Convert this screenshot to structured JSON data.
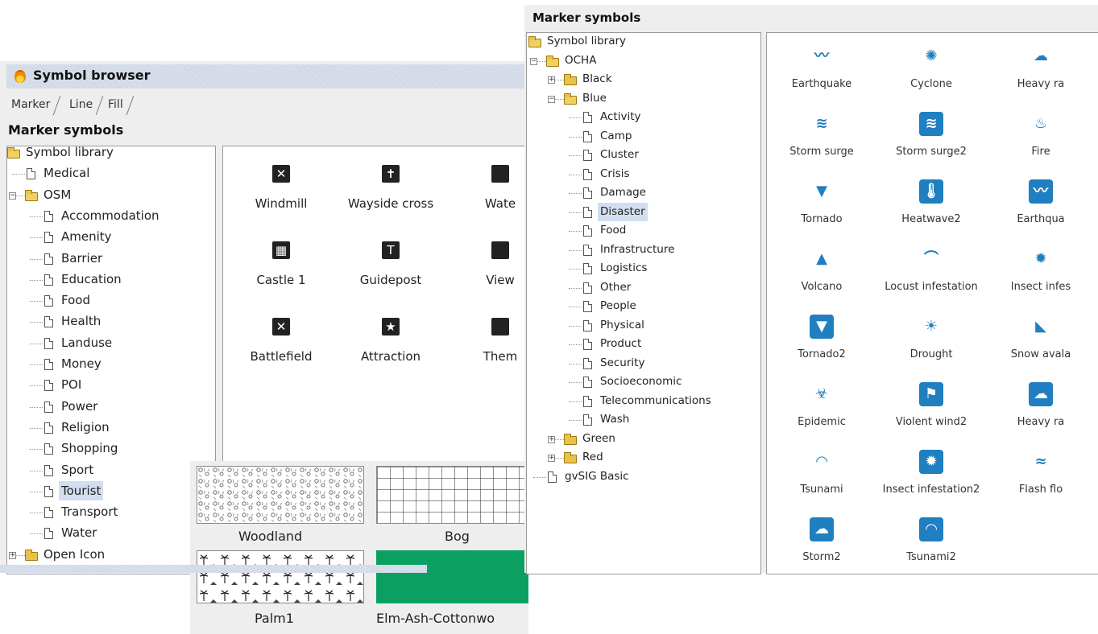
{
  "left": {
    "title": "Symbol browser",
    "tabs": [
      "Marker",
      "Line",
      "Fill"
    ],
    "header": "Marker symbols",
    "tree": [
      {
        "label": "Symbol library",
        "kind": "folder-open",
        "level": 0
      },
      {
        "label": "Medical",
        "kind": "doc",
        "level": 1
      },
      {
        "label": "OSM",
        "kind": "folder-open",
        "level": 1,
        "toggle": "-"
      },
      {
        "label": "Accommodation",
        "kind": "doc",
        "level": 2
      },
      {
        "label": "Amenity",
        "kind": "doc",
        "level": 2
      },
      {
        "label": "Barrier",
        "kind": "doc",
        "level": 2
      },
      {
        "label": "Education",
        "kind": "doc",
        "level": 2
      },
      {
        "label": "Food",
        "kind": "doc",
        "level": 2
      },
      {
        "label": "Health",
        "kind": "doc",
        "level": 2
      },
      {
        "label": "Landuse",
        "kind": "doc",
        "level": 2
      },
      {
        "label": "Money",
        "kind": "doc",
        "level": 2
      },
      {
        "label": "POI",
        "kind": "doc",
        "level": 2
      },
      {
        "label": "Power",
        "kind": "doc",
        "level": 2
      },
      {
        "label": "Religion",
        "kind": "doc",
        "level": 2
      },
      {
        "label": "Shopping",
        "kind": "doc",
        "level": 2
      },
      {
        "label": "Sport",
        "kind": "doc",
        "level": 2
      },
      {
        "label": "Tourist",
        "kind": "doc",
        "level": 2,
        "selected": true
      },
      {
        "label": "Transport",
        "kind": "doc",
        "level": 2
      },
      {
        "label": "Water",
        "kind": "doc",
        "level": 2
      },
      {
        "label": "Open Icon",
        "kind": "folder",
        "level": 1,
        "toggle": "+"
      }
    ],
    "symbols": [
      {
        "label": "Windmill",
        "icon": "windmill-icon",
        "glyph": "✕"
      },
      {
        "label": "Wayside cross",
        "icon": "wayside-cross-icon",
        "glyph": "✝"
      },
      {
        "label": "Wate",
        "icon": "water-icon",
        "glyph": ""
      },
      {
        "label": "Castle 1",
        "icon": "castle-icon",
        "glyph": "▦"
      },
      {
        "label": "Guidepost",
        "icon": "guidepost-icon",
        "glyph": "T"
      },
      {
        "label": "View",
        "icon": "viewpoint-icon",
        "glyph": ""
      },
      {
        "label": "Battlefield",
        "icon": "battlefield-icon",
        "glyph": "✕"
      },
      {
        "label": "Attraction",
        "icon": "attraction-icon",
        "glyph": "★"
      },
      {
        "label": "Them",
        "icon": "theme-park-icon",
        "glyph": ""
      }
    ],
    "fills": [
      {
        "label": "Woodland",
        "pattern": "woodland"
      },
      {
        "label": "Bog",
        "pattern": "grid"
      },
      {
        "label": "Palm1",
        "pattern": "palm"
      },
      {
        "label": "Elm-Ash-Cottonwo",
        "pattern": "solid",
        "color": "#0aa062"
      }
    ]
  },
  "right": {
    "header": "Marker symbols",
    "tree": [
      {
        "label": "Symbol library",
        "kind": "folder-open",
        "level": 0
      },
      {
        "label": "OCHA",
        "kind": "folder-open",
        "level": 1,
        "toggle": "-"
      },
      {
        "label": "Black",
        "kind": "folder",
        "level": 2,
        "toggle": "+"
      },
      {
        "label": "Blue",
        "kind": "folder-open",
        "level": 2,
        "toggle": "-"
      },
      {
        "label": "Activity",
        "kind": "doc",
        "level": 3
      },
      {
        "label": "Camp",
        "kind": "doc",
        "level": 3
      },
      {
        "label": "Cluster",
        "kind": "doc",
        "level": 3
      },
      {
        "label": "Crisis",
        "kind": "doc",
        "level": 3
      },
      {
        "label": "Damage",
        "kind": "doc",
        "level": 3
      },
      {
        "label": "Disaster",
        "kind": "doc",
        "level": 3,
        "selected": true
      },
      {
        "label": "Food",
        "kind": "doc",
        "level": 3
      },
      {
        "label": "Infrastructure",
        "kind": "doc",
        "level": 3
      },
      {
        "label": "Logistics",
        "kind": "doc",
        "level": 3
      },
      {
        "label": "Other",
        "kind": "doc",
        "level": 3
      },
      {
        "label": "People",
        "kind": "doc",
        "level": 3
      },
      {
        "label": "Physical",
        "kind": "doc",
        "level": 3
      },
      {
        "label": "Product",
        "kind": "doc",
        "level": 3
      },
      {
        "label": "Security",
        "kind": "doc",
        "level": 3
      },
      {
        "label": "Socioeconomic",
        "kind": "doc",
        "level": 3
      },
      {
        "label": "Telecommunications",
        "kind": "doc",
        "level": 3
      },
      {
        "label": "Wash",
        "kind": "doc",
        "level": 3
      },
      {
        "label": "Green",
        "kind": "folder",
        "level": 2,
        "toggle": "+"
      },
      {
        "label": "Red",
        "kind": "folder",
        "level": 2,
        "toggle": "+"
      },
      {
        "label": "gvSIG Basic",
        "kind": "doc",
        "level": 1
      }
    ],
    "symbols": [
      {
        "label": "Earthquake",
        "icon": "earthquake-icon",
        "glyph": "〰",
        "box": false
      },
      {
        "label": "Cyclone",
        "icon": "cyclone-icon",
        "glyph": "✺",
        "box": false
      },
      {
        "label": "Heavy ra",
        "icon": "heavy-rain-icon",
        "glyph": "☁",
        "box": false
      },
      {
        "label": "Storm surge",
        "icon": "storm-surge-icon",
        "glyph": "≋",
        "box": false
      },
      {
        "label": "Storm surge2",
        "icon": "storm-surge2-icon",
        "glyph": "≋",
        "box": true
      },
      {
        "label": "Fire",
        "icon": "fire-icon",
        "glyph": "♨",
        "box": false
      },
      {
        "label": "Tornado",
        "icon": "tornado-icon",
        "glyph": "▼",
        "box": false
      },
      {
        "label": "Heatwave2",
        "icon": "heatwave2-icon",
        "glyph": "🌡",
        "box": true
      },
      {
        "label": "Earthqua",
        "icon": "earthquake2-icon",
        "glyph": "〰",
        "box": true
      },
      {
        "label": "Volcano",
        "icon": "volcano-icon",
        "glyph": "▲",
        "box": false
      },
      {
        "label": "Locust infestation",
        "icon": "locust-icon",
        "glyph": "⌒",
        "box": false
      },
      {
        "label": "Insect infes",
        "icon": "insect-icon",
        "glyph": "✹",
        "box": false
      },
      {
        "label": "Tornado2",
        "icon": "tornado2-icon",
        "glyph": "▼",
        "box": true
      },
      {
        "label": "Drought",
        "icon": "drought-icon",
        "glyph": "☀",
        "box": false
      },
      {
        "label": "Snow avala",
        "icon": "snow-avalanche-icon",
        "glyph": "◣",
        "box": false
      },
      {
        "label": "Epidemic",
        "icon": "epidemic-icon",
        "glyph": "☣",
        "box": false
      },
      {
        "label": "Violent wind2",
        "icon": "violent-wind2-icon",
        "glyph": "⚑",
        "box": true
      },
      {
        "label": "Heavy ra",
        "icon": "heavy-rain2-icon",
        "glyph": "☁",
        "box": true
      },
      {
        "label": "Tsunami",
        "icon": "tsunami-icon",
        "glyph": "◠",
        "box": false
      },
      {
        "label": "Insect infestation2",
        "icon": "insect2-icon",
        "glyph": "✹",
        "box": true
      },
      {
        "label": "Flash flo",
        "icon": "flash-flood-icon",
        "glyph": "≈",
        "box": false
      },
      {
        "label": "Storm2",
        "icon": "storm2-icon",
        "glyph": "☁",
        "box": true
      },
      {
        "label": "Tsunami2",
        "icon": "tsunami2-icon",
        "glyph": "◠",
        "box": true
      }
    ],
    "accent": "#1f7fc1"
  }
}
